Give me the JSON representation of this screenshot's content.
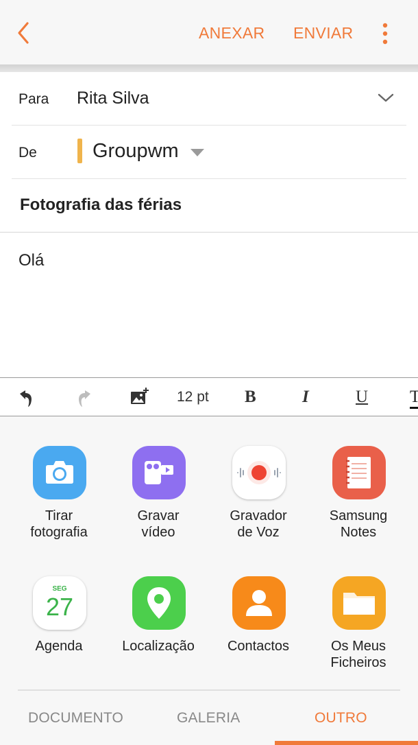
{
  "toolbar": {
    "attach_label": "ANEXAR",
    "send_label": "ENVIAR",
    "accent_color": "#f07a3a"
  },
  "compose": {
    "to_label": "Para",
    "to_value": "Rita Silva",
    "from_label": "De",
    "from_value": "Groupwm",
    "subject": "Fotografia das férias",
    "body": "Olá"
  },
  "format_bar": {
    "font_size": "12 pt",
    "bold": "B",
    "italic": "I",
    "underline": "U",
    "strike": "T"
  },
  "attach_options": [
    {
      "label_1": "Tirar",
      "label_2": "fotografia",
      "icon": "camera-icon",
      "color": "#4aa9f0"
    },
    {
      "label_1": "Gravar",
      "label_2": "vídeo",
      "icon": "video-camera-icon",
      "color": "#8e6ff0"
    },
    {
      "label_1": "Gravador",
      "label_2": "de Voz",
      "icon": "voice-recorder-icon",
      "color": "#ffffff"
    },
    {
      "label_1": "Samsung",
      "label_2": "Notes",
      "icon": "notes-icon",
      "color": "#e9604a"
    },
    {
      "label_1": "Agenda",
      "label_2": "",
      "icon": "calendar-icon",
      "color": "#ffffff",
      "calendar_day_name": "SEG",
      "calendar_day": "27"
    },
    {
      "label_1": "Localização",
      "label_2": "",
      "icon": "location-pin-icon",
      "color": "#4ccf4c"
    },
    {
      "label_1": "Contactos",
      "label_2": "",
      "icon": "contacts-icon",
      "color": "#f78a1a"
    },
    {
      "label_1": "Os Meus",
      "label_2": "Ficheiros",
      "icon": "folder-icon",
      "color": "#f5a623"
    }
  ],
  "tabs": [
    {
      "label": "DOCUMENTO",
      "active": false
    },
    {
      "label": "GALERIA",
      "active": false
    },
    {
      "label": "OUTRO",
      "active": true
    }
  ]
}
